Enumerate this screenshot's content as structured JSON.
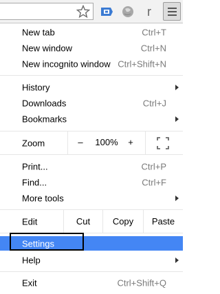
{
  "toolbar": {
    "icons": [
      "bookmark-star-icon",
      "extension-icon",
      "extension-icon",
      "extension-icon",
      "chrome-menu-icon"
    ],
    "extension3_glyph": "r"
  },
  "menu": {
    "new_tab": {
      "label": "New tab",
      "shortcut": "Ctrl+T"
    },
    "new_window": {
      "label": "New window",
      "shortcut": "Ctrl+N"
    },
    "new_incognito": {
      "label": "New incognito window",
      "shortcut": "Ctrl+Shift+N"
    },
    "history": {
      "label": "History"
    },
    "downloads": {
      "label": "Downloads",
      "shortcut": "Ctrl+J"
    },
    "bookmarks": {
      "label": "Bookmarks"
    },
    "zoom": {
      "label": "Zoom",
      "minus": "–",
      "value": "100%",
      "plus": "+"
    },
    "print": {
      "label": "Print...",
      "shortcut": "Ctrl+P"
    },
    "find": {
      "label": "Find...",
      "shortcut": "Ctrl+F"
    },
    "more_tools": {
      "label": "More tools"
    },
    "edit": {
      "label": "Edit",
      "cut": "Cut",
      "copy": "Copy",
      "paste": "Paste"
    },
    "settings": {
      "label": "Settings"
    },
    "help": {
      "label": "Help"
    },
    "exit": {
      "label": "Exit",
      "shortcut": "Ctrl+Shift+Q"
    }
  },
  "colors": {
    "highlight": "#4486f4",
    "shortcut_text": "#7a7a7a"
  }
}
